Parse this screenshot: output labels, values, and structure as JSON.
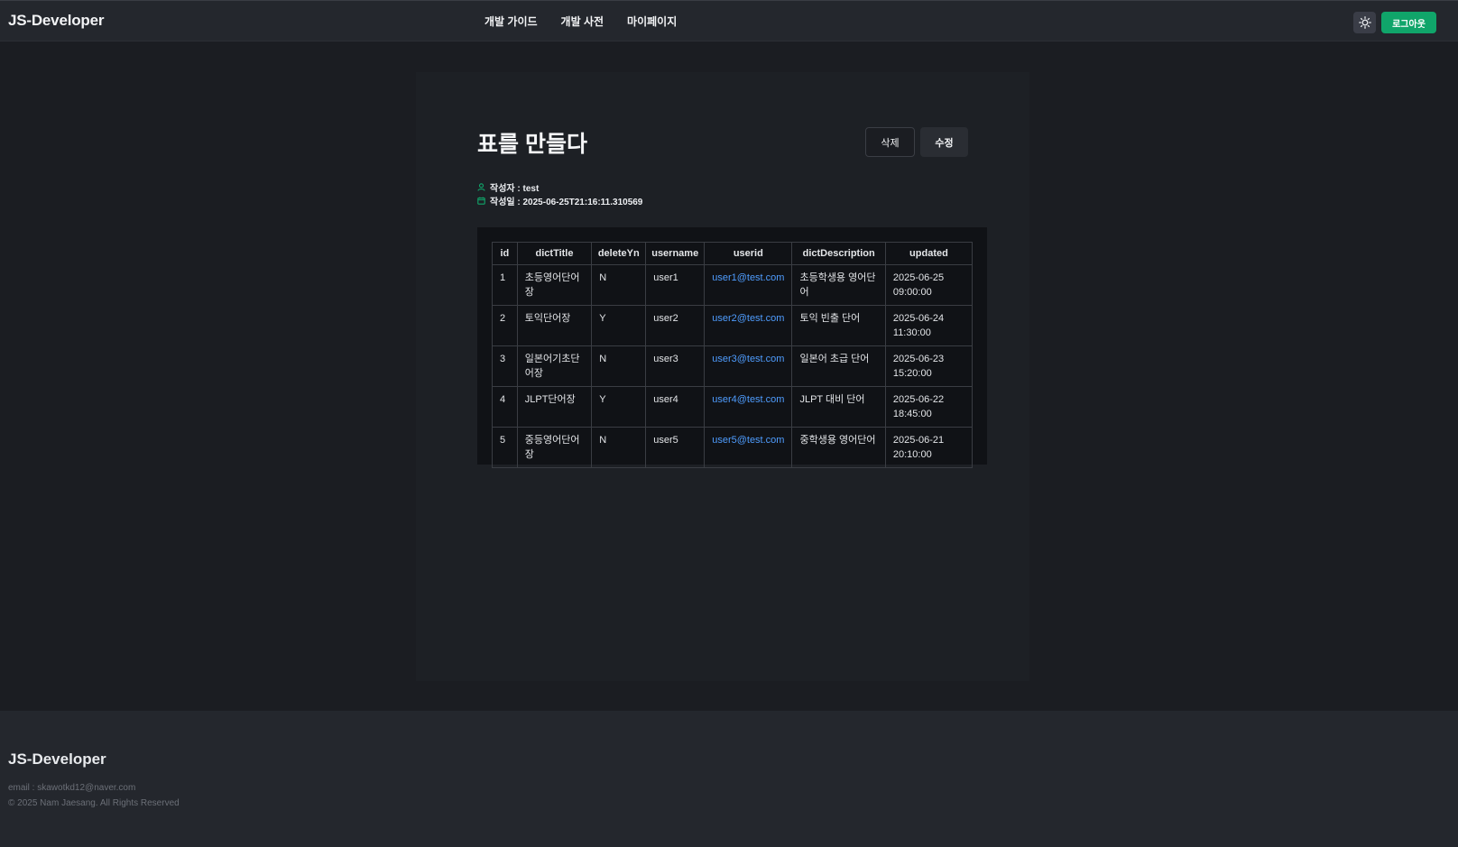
{
  "header": {
    "logo": "JS-Developer",
    "nav": [
      {
        "label": "개발 가이드"
      },
      {
        "label": "개발 사전"
      },
      {
        "label": "마이페이지"
      }
    ],
    "theme_icon": "sun-icon",
    "logout_label": "로그아웃"
  },
  "post": {
    "title": "표를 만들다",
    "delete_label": "삭제",
    "edit_label": "수정",
    "author": "작성자 : test",
    "date": "작성일 : 2025-06-25T21:16:11.310569"
  },
  "table": {
    "columns": [
      "id",
      "dictTitle",
      "deleteYn",
      "username",
      "userid",
      "dictDescription",
      "updated"
    ],
    "rows": [
      [
        "1",
        "초등영어단어장",
        "N",
        "user1",
        "user1@test.com",
        "초등학생용 영어단어",
        "2025-06-25 09:00:00"
      ],
      [
        "2",
        "토익단어장",
        "Y",
        "user2",
        "user2@test.com",
        "토익 빈출 단어",
        "2025-06-24 11:30:00"
      ],
      [
        "3",
        "일본어기초단어장",
        "N",
        "user3",
        "user3@test.com",
        "일본어 초급 단어",
        "2025-06-23 15:20:00"
      ],
      [
        "4",
        "JLPT단어장",
        "Y",
        "user4",
        "user4@test.com",
        "JLPT 대비 단어",
        "2025-06-22 18:45:00"
      ],
      [
        "5",
        "중등영어단어장",
        "N",
        "user5",
        "user5@test.com",
        "중학생용 영어단어",
        "2025-06-21 20:10:00"
      ]
    ]
  },
  "footer": {
    "logo": "JS-Developer",
    "email": "email : skawotkd12@naver.com",
    "copyright": "© 2025 Nam Jaesang. All Rights Reserved"
  },
  "colors": {
    "accent": "#10a56a",
    "link": "#4f9dff",
    "background": "#1b1d22"
  }
}
